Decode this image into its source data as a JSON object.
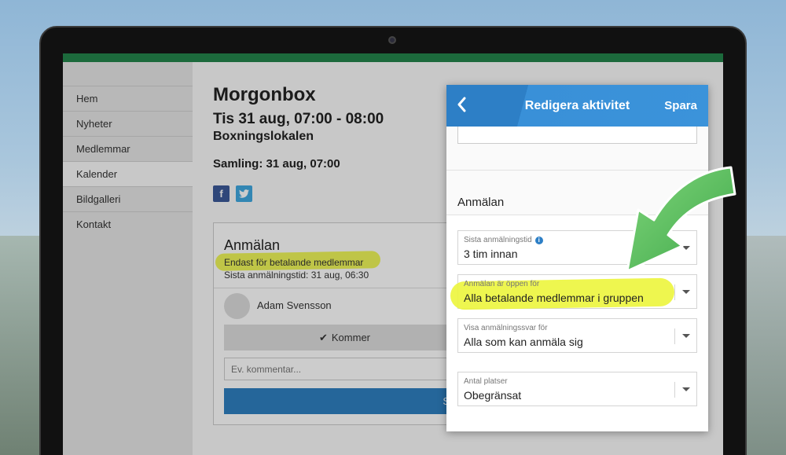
{
  "sidebar": {
    "items": [
      {
        "label": "Hem"
      },
      {
        "label": "Nyheter"
      },
      {
        "label": "Medlemmar"
      },
      {
        "label": "Kalender"
      },
      {
        "label": "Bildgalleri"
      },
      {
        "label": "Kontakt"
      }
    ]
  },
  "event": {
    "title": "Morgonbox",
    "date": "Tis 31 aug, 07:00 - 08:00",
    "location": "Boxningslokalen",
    "gathering": "Samling: 31 aug, 07:00"
  },
  "registration_card": {
    "title": "Anmälan",
    "restriction": "Endast för betalande medlemmar",
    "deadline": "Sista anmälningstid: 31 aug, 06:30",
    "member_name": "Adam Svensson",
    "coming_label": "Kommer",
    "comment_placeholder": "Ev. kommentar...",
    "send_label": "S"
  },
  "modal": {
    "title": "Redigera aktivitet",
    "save_label": "Spara",
    "back_icon": "chevron-left-icon",
    "section_title": "Anmälan",
    "fields": [
      {
        "label": "Sista anmälningstid",
        "value": "3 tim innan",
        "has_info_icon": true
      },
      {
        "label": "Anmälan är öppen för",
        "value": "Alla betalande medlemmar i gruppen",
        "highlighted": true
      },
      {
        "label": "Visa anmälningssvar för",
        "value": "Alla som kan anmäla sig"
      },
      {
        "label": "Antal platser",
        "value": "Obegränsat"
      }
    ]
  },
  "colors": {
    "header_blue": "#2d7fc6",
    "top_green": "#1c6a3c",
    "highlight_yellow": "#ecf53c",
    "arrow_green": "#5fbf5f"
  }
}
